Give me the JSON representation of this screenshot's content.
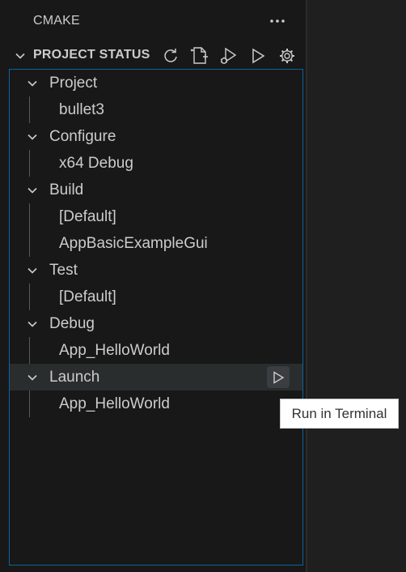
{
  "panel": {
    "title": "CMAKE",
    "more_icon": "ellipsis-icon"
  },
  "section": {
    "title": "PROJECT STATUS",
    "toolbar": [
      {
        "icon": "refresh-icon"
      },
      {
        "icon": "new-file-icon"
      },
      {
        "icon": "debug-icon"
      },
      {
        "icon": "run-icon"
      },
      {
        "icon": "settings-gear-icon"
      }
    ]
  },
  "tree": {
    "groups": [
      {
        "label": "Project",
        "children": [
          "bullet3"
        ]
      },
      {
        "label": "Configure",
        "children": [
          "x64 Debug"
        ]
      },
      {
        "label": "Build",
        "children": [
          "[Default]",
          "AppBasicExampleGui"
        ]
      },
      {
        "label": "Test",
        "children": [
          "[Default]"
        ]
      },
      {
        "label": "Debug",
        "children": [
          "App_HelloWorld"
        ]
      },
      {
        "label": "Launch",
        "children": [
          "App_HelloWorld"
        ]
      }
    ]
  },
  "tooltip": {
    "text": "Run in Terminal"
  },
  "colors": {
    "background": "#181818",
    "focus_border": "#0e639c",
    "hover_row": "#2a2d2e",
    "text": "#cccccc"
  }
}
